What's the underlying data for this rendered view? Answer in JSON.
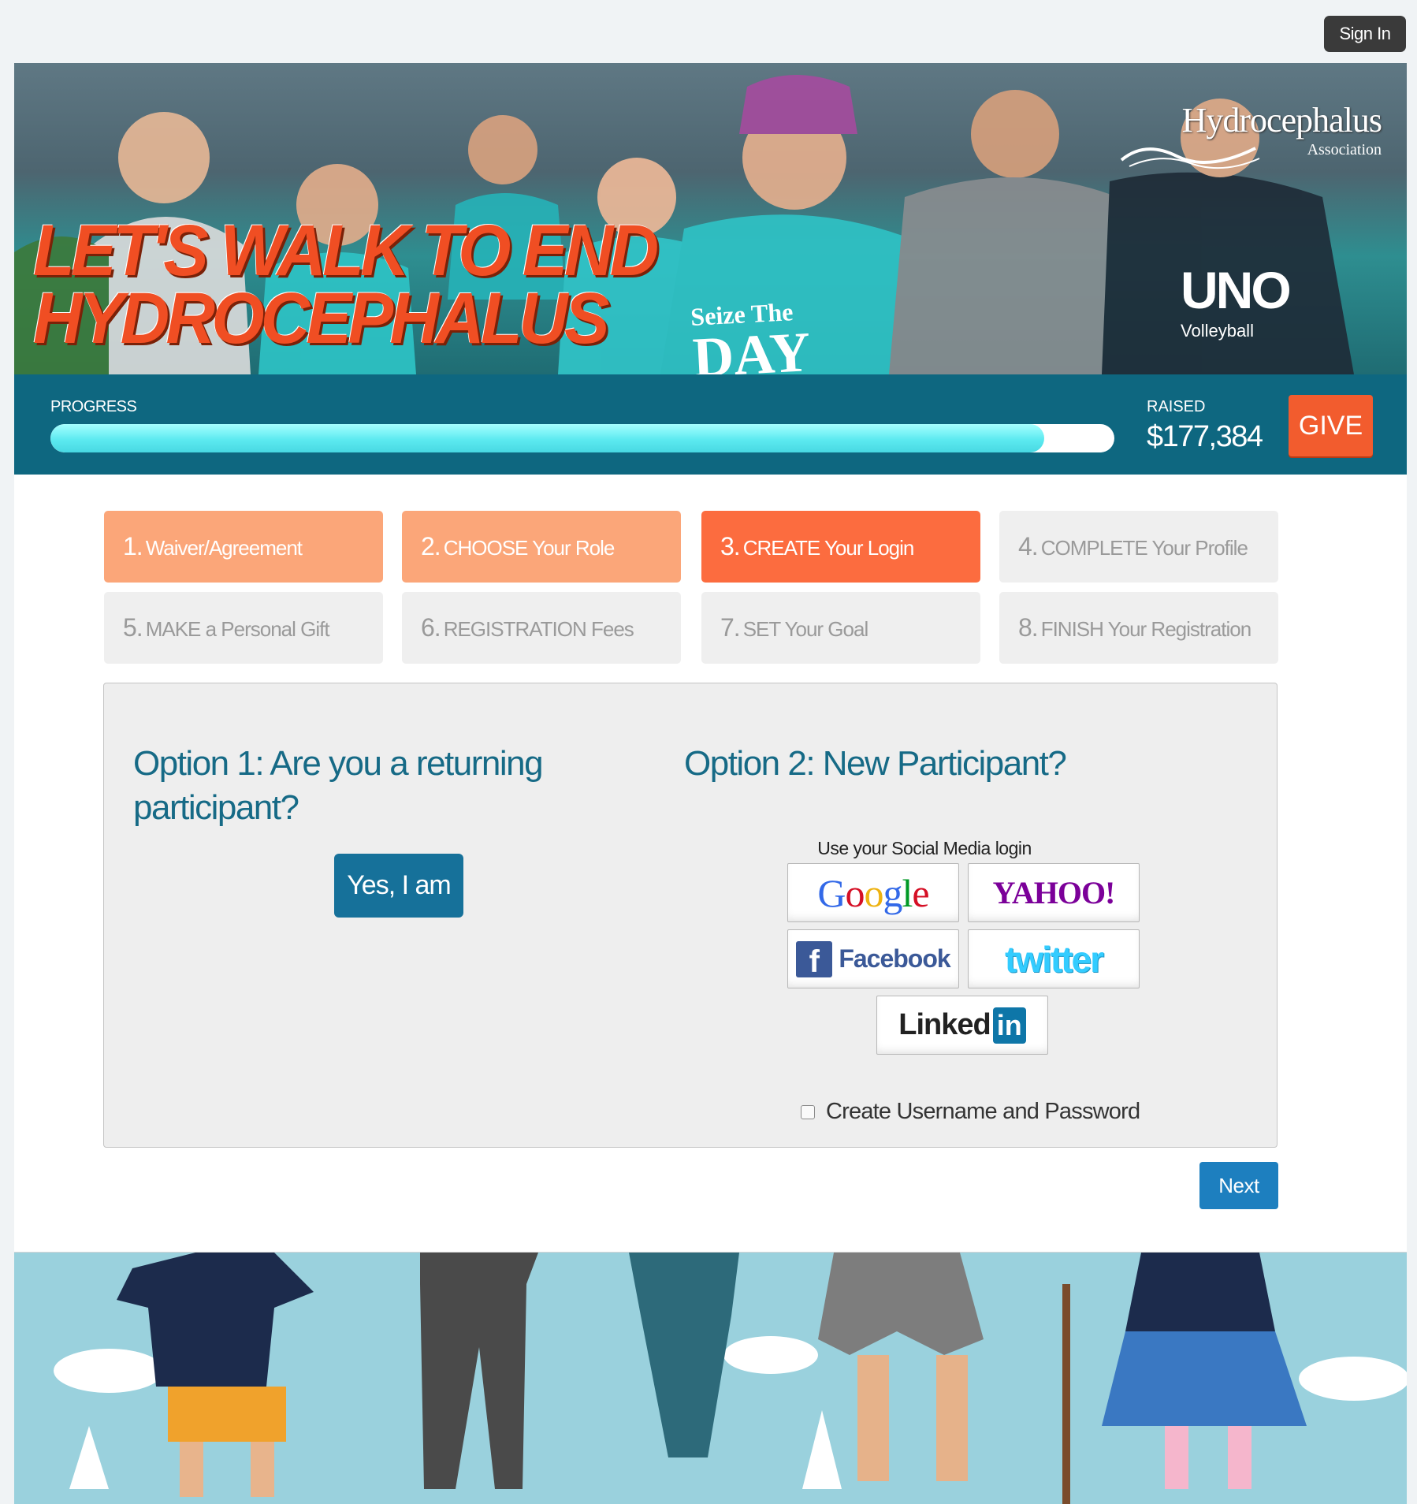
{
  "header": {
    "sign_in_label": "Sign In"
  },
  "hero": {
    "headline_line1": "LET'S WALK TO END",
    "headline_line2": "HYDROCEPHALUS",
    "logo_name": "Hydrocephalus",
    "logo_sub": "Association",
    "shirt_line1": "Seize The",
    "shirt_line2": "DAY",
    "uno_big": "UNO",
    "uno_small": "Volleyball"
  },
  "progress": {
    "label": "PROGRESS",
    "fraction": 0.934,
    "raised_label": "RAISED",
    "raised_amount": "$177,384",
    "give_label": "GIVE"
  },
  "steps": [
    {
      "num": "1.",
      "label": "Waiver/Agreement",
      "state": "done"
    },
    {
      "num": "2.",
      "label": "CHOOSE Your Role",
      "state": "done"
    },
    {
      "num": "3.",
      "label": "CREATE Your Login",
      "state": "active"
    },
    {
      "num": "4.",
      "label": "COMPLETE Your Profile",
      "state": "todo"
    },
    {
      "num": "5.",
      "label": "MAKE a Personal Gift",
      "state": "todo"
    },
    {
      "num": "6.",
      "label": "REGISTRATION Fees",
      "state": "todo"
    },
    {
      "num": "7.",
      "label": "SET Your Goal",
      "state": "todo"
    },
    {
      "num": "8.",
      "label": "FINISH Your Registration",
      "state": "todo"
    }
  ],
  "options": {
    "option1_title": "Option 1: Are you a returning participant?",
    "yes_label": "Yes, I am",
    "option2_title": "Option 2: New Participant?",
    "social_label": "Use your Social Media login",
    "google": "Google",
    "yahoo": "YAHOO!",
    "facebook_icon": "f",
    "facebook": "Facebook",
    "twitter": "twitter",
    "linkedin_a": "Linked",
    "linkedin_b": "in",
    "create_label": "Create Username and Password"
  },
  "footer": {
    "next_label": "Next"
  },
  "colors": {
    "band": "#0e6780",
    "accent": "#fc6c3f",
    "title": "#166a86",
    "button": "#16719a"
  }
}
